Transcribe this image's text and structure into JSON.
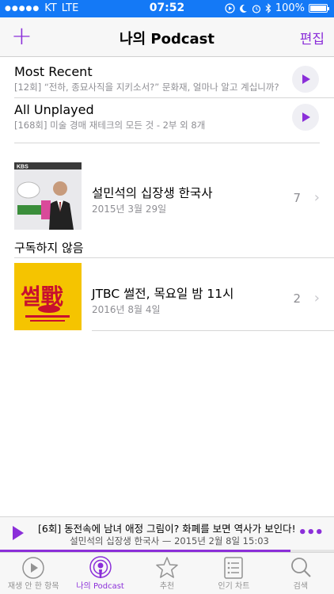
{
  "status_bar": {
    "carrier": "KT",
    "network": "LTE",
    "time": "07:52",
    "battery": "100%",
    "battery_level": 1.0
  },
  "nav": {
    "add_label": "+",
    "title": "나의 Podcast",
    "edit_label": "편집"
  },
  "playlists": [
    {
      "name": "Most Recent",
      "subtitle": "[12회] “전하, 종묘사직을 지키소서?” 문화재, 얼마나 알고 계십니까?"
    },
    {
      "name": "All Unplayed",
      "subtitle": "[168회] 미술 경매 재테크의 모든 것 - 2부 외 8개"
    }
  ],
  "podcasts": [
    {
      "title": "설민석의 십장생 한국사",
      "date": "2015년 3월 29일",
      "count": "7",
      "art_label": "KBS"
    },
    {
      "title": "JTBC 썰전, 목요일 밤 11시",
      "date": "2016년 8월 4일",
      "count": "2",
      "art_label": "썰戰"
    }
  ],
  "section_unsubscribed": "구독하지 않음",
  "mini_player": {
    "episode": "[6회] 동전속에 남녀 애정 그림이? 화폐를 보면 역사가 보인다!",
    "meta": "설민석의 십장생 한국사 — 2015년 2월 8일 15:03",
    "more_label": "•••",
    "progress": 0.87
  },
  "tabs": [
    {
      "label": "재생 안 한 항목",
      "icon": "play-circle-icon",
      "active": false
    },
    {
      "label": "나의 Podcast",
      "icon": "podcast-icon",
      "active": true
    },
    {
      "label": "추천",
      "icon": "star-icon",
      "active": false
    },
    {
      "label": "인기 차트",
      "icon": "list-icon",
      "active": false
    },
    {
      "label": "검색",
      "icon": "search-icon",
      "active": false
    }
  ],
  "colors": {
    "accent": "#8b2fd9",
    "status_bar": "#1479f6",
    "jtbc_art_bg": "#f5c400"
  }
}
